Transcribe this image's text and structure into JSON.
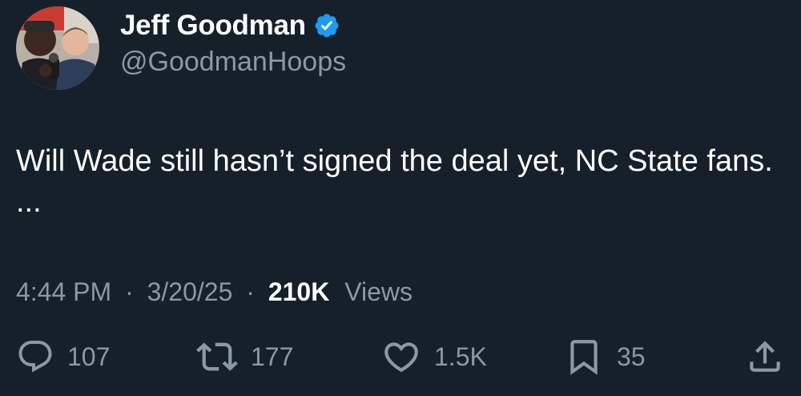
{
  "author": {
    "display_name": "Jeff Goodman",
    "handle": "@GoodmanHoops",
    "verified_icon": "verified-badge-icon"
  },
  "tweet": {
    "text": "Will Wade still hasn’t signed the deal yet, NC State fans. ..."
  },
  "meta": {
    "time": "4:44 PM",
    "separator": "·",
    "date": "3/20/25",
    "views_count": "210K",
    "views_label": "Views"
  },
  "actions": {
    "replies": "107",
    "reposts": "177",
    "likes": "1.5K",
    "bookmarks": "35"
  },
  "colors": {
    "background": "#15202b",
    "primary_text": "#ffffff",
    "secondary_text": "#8b98a5",
    "verified": "#1d9bf0"
  }
}
